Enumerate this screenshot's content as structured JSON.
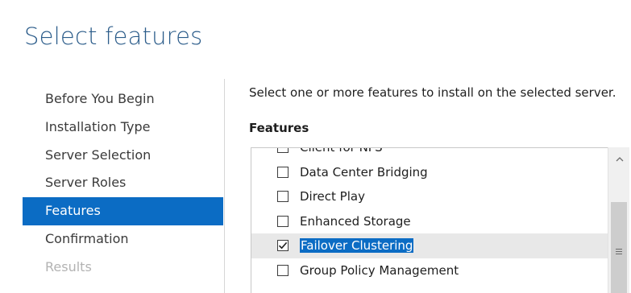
{
  "page": {
    "title": "Select features"
  },
  "nav": {
    "items": [
      {
        "label": "Before You Begin",
        "state": "normal"
      },
      {
        "label": "Installation Type",
        "state": "normal"
      },
      {
        "label": "Server Selection",
        "state": "normal"
      },
      {
        "label": "Server Roles",
        "state": "normal"
      },
      {
        "label": "Features",
        "state": "active"
      },
      {
        "label": "Confirmation",
        "state": "normal"
      },
      {
        "label": "Results",
        "state": "disabled"
      }
    ]
  },
  "content": {
    "instruction": "Select one or more features to install on the selected server.",
    "features_label": "Features",
    "features": [
      {
        "label": "Client for NFS",
        "checked": false
      },
      {
        "label": "Data Center Bridging",
        "checked": false
      },
      {
        "label": "Direct Play",
        "checked": false
      },
      {
        "label": "Enhanced Storage",
        "checked": false
      },
      {
        "label": "Failover Clustering",
        "checked": true
      },
      {
        "label": "Group Policy Management",
        "checked": false
      }
    ],
    "selected_feature": "Failover Clustering"
  },
  "scrollbar": {
    "up_icon": "chevron-up-icon",
    "grip_icon": "grip-lines-icon"
  },
  "colors": {
    "title": "#2b5c8a",
    "accent": "#0b6cc4",
    "disabled_text": "#b3b3b3",
    "selected_row": "#e8e8e8"
  }
}
